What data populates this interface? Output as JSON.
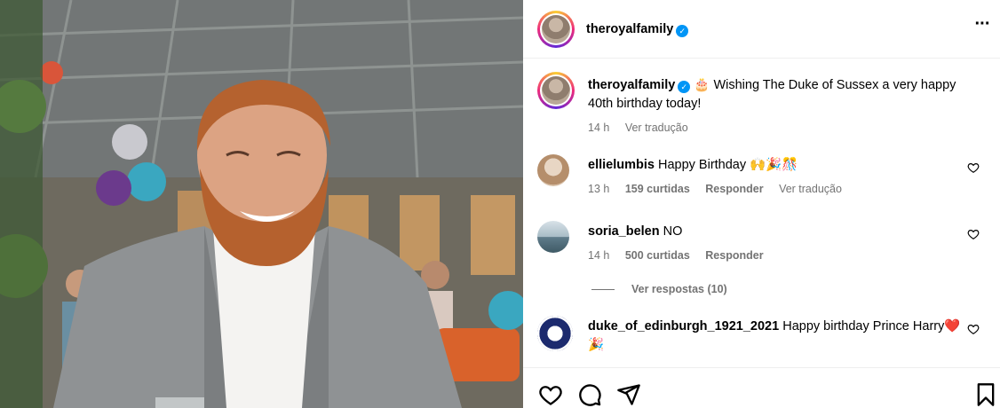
{
  "post": {
    "account": "theroyalfamily",
    "verified_mark": "✓",
    "more_icon": "more-horizontal-icon"
  },
  "caption": {
    "username": "theroyalfamily",
    "emoji": "🎂",
    "text": "Wishing The Duke of Sussex a very happy 40th birthday today!",
    "time": "14 h",
    "translate": "Ver tradução"
  },
  "comments": [
    {
      "username": "ellielumbis",
      "text": "Happy Birthday 🙌🎉🎊",
      "time": "13 h",
      "likes": "159 curtidas",
      "reply": "Responder",
      "translate": "Ver tradução"
    },
    {
      "username": "soria_belen",
      "text": "NO",
      "time": "14 h",
      "likes": "500 curtidas",
      "reply": "Responder",
      "view_replies": "Ver respostas (10)"
    },
    {
      "username": "duke_of_edinburgh_1921_2021",
      "text": "Happy birthday Prince Harry❤️🎉"
    }
  ],
  "actions": {
    "like_icon": "heart-icon",
    "comment_icon": "comment-icon",
    "share_icon": "share-icon",
    "save_icon": "bookmark-icon"
  },
  "colors": {
    "verified": "#0095f6",
    "muted": "#737373",
    "divider": "#efefef"
  }
}
